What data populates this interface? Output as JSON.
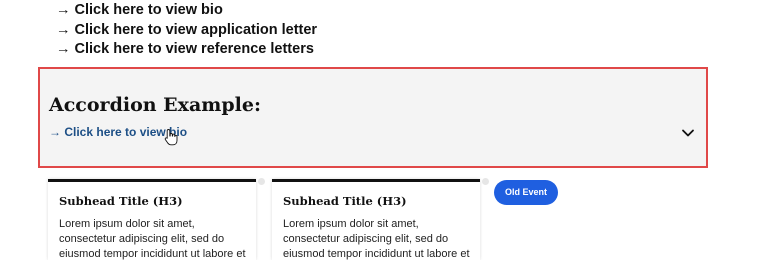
{
  "links": [
    {
      "arrow": "→",
      "label": "Click here to view bio"
    },
    {
      "arrow": "→",
      "label": "Click here to view application letter"
    },
    {
      "arrow": "→",
      "label": "Click here to view reference letters"
    }
  ],
  "accordion": {
    "title": "Accordion Example:",
    "toggle_arrow": "→",
    "toggle_label": "Click here to view bio",
    "expanded": false,
    "border_color": "#e04848",
    "icon": "chevron-down-icon"
  },
  "cards": [
    {
      "title": "Subhead Title (H3)",
      "body": "Lorem ipsum dolor sit amet, consectetur adipiscing elit, sed do eiusmod tempor incididunt ut labore et"
    },
    {
      "title": "Subhead Title (H3)",
      "body": "Lorem ipsum dolor sit amet, consectetur adipiscing elit, sed do eiusmod tempor incididunt ut labore et"
    }
  ],
  "badge": {
    "label": "Old Event",
    "color": "#1f5fe0"
  },
  "cursor": "hand-pointer-icon"
}
